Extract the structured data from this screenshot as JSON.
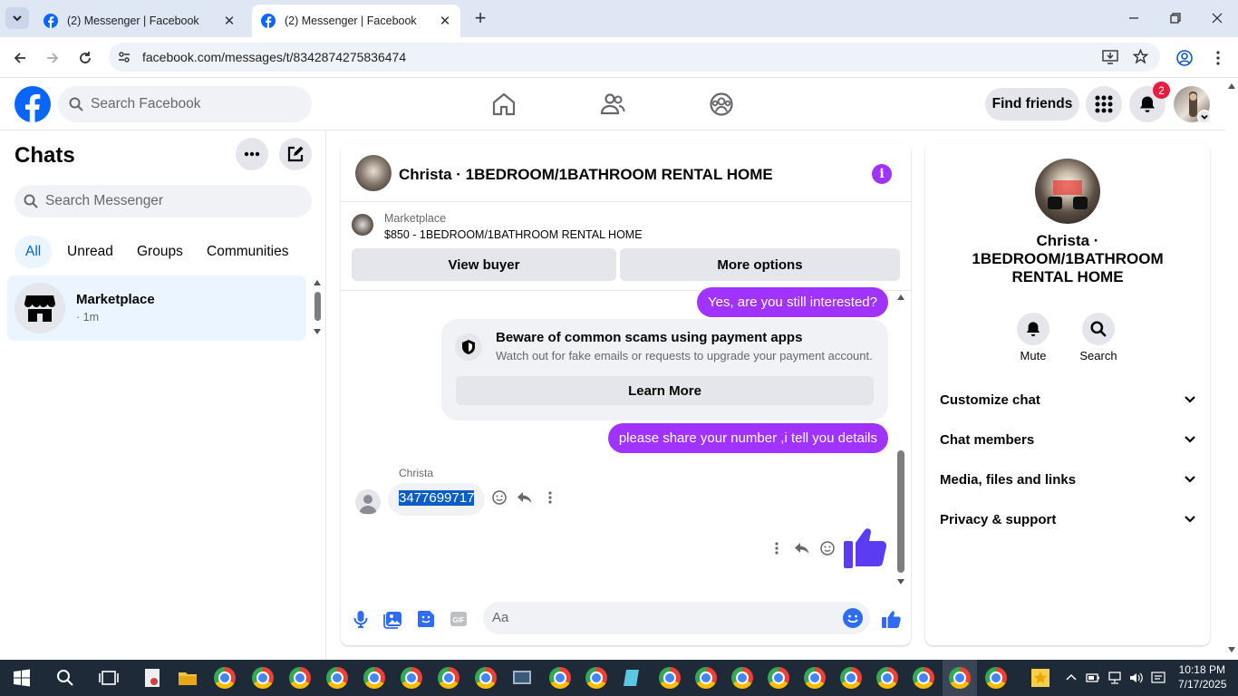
{
  "browser": {
    "tabs": [
      {
        "title": "(2) Messenger | Facebook",
        "active": false
      },
      {
        "title": "(2) Messenger | Facebook",
        "active": true
      }
    ],
    "url": "facebook.com/messages/t/8342874275836474"
  },
  "fb_header": {
    "search_placeholder": "Search Facebook",
    "find_friends": "Find friends",
    "notification_count": "2"
  },
  "left": {
    "title": "Chats",
    "search_placeholder": "Search Messenger",
    "filters": [
      "All",
      "Unread",
      "Groups",
      "Communities"
    ],
    "chat": {
      "name": "Marketplace",
      "time": "· 1m"
    }
  },
  "conversation": {
    "title": "Christa · 1BEDROOM/1BATHROOM RENTAL HOME",
    "marketplace_label": "Marketplace",
    "listing": "$850 - 1BEDROOM/1BATHROOM RENTAL HOME",
    "view_buyer": "View buyer",
    "more_options": "More options",
    "messages": {
      "out1": "Yes, are you still interested?",
      "warning_title": "Beware of common scams using payment apps",
      "warning_text": "Watch out for fake emails or requests to upgrade your payment account.",
      "learn_more": "Learn More",
      "out2": "please share your number ,i tell you details",
      "sender": "Christa",
      "phone": "3477699717"
    },
    "composer_placeholder": "Aa"
  },
  "right": {
    "name": "Christa · 1BEDROOM/1BATHROOM RENTAL HOME",
    "actions": [
      "Mute",
      "Search"
    ],
    "sections": [
      "Customize chat",
      "Chat members",
      "Media, files and links",
      "Privacy & support"
    ]
  },
  "taskbar": {
    "time": "10:18 PM",
    "date": "7/17/2025"
  },
  "colors": {
    "accent": "#a033ff",
    "fb_blue": "#0866ff",
    "like_blue": "#2e6cf6"
  }
}
